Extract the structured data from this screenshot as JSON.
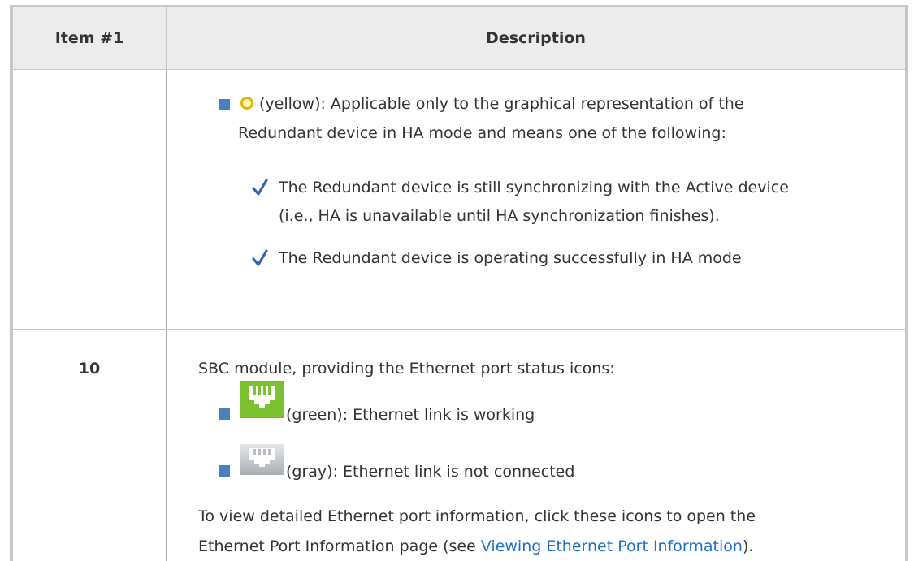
{
  "table": {
    "headers": [
      "Item #1",
      "Description"
    ],
    "row_continued": {
      "bullet_yellow": {
        "icon": "yellow-status-circle-icon",
        "line1": "(yellow): Applicable only to the graphical representation of the",
        "line2": "Redundant device in HA mode and means one of the following:"
      },
      "sub_items": [
        {
          "line1": "The Redundant device is still synchronizing with the Active device",
          "line2": "(i.e., HA is unavailable until HA synchronization finishes)."
        },
        {
          "line1": "The Redundant device is operating successfully in HA mode"
        }
      ]
    },
    "row_10": {
      "item": "10",
      "intro": "SBC module, providing the Ethernet port status icons:",
      "bullets": [
        {
          "icon": "ethernet-port-green-icon",
          "text": "(green): Ethernet link is working"
        },
        {
          "icon": "ethernet-port-gray-icon",
          "text": "(gray): Ethernet link is not connected"
        }
      ],
      "footer_line1": "To view detailed Ethernet port information, click these icons to open the",
      "footer_line2_prefix": "Ethernet Port Information page (see ",
      "footer_link": "Viewing Ethernet Port Information",
      "footer_line2_suffix": ")."
    }
  },
  "colors": {
    "bullet": "#4a7fc1",
    "check": "#2e63b8",
    "link": "#1f6fd1",
    "header_bg": "#ececec",
    "border": "#c7c7c7",
    "eth_green": "#7cc22e",
    "eth_gray": "#b9bfc4"
  }
}
